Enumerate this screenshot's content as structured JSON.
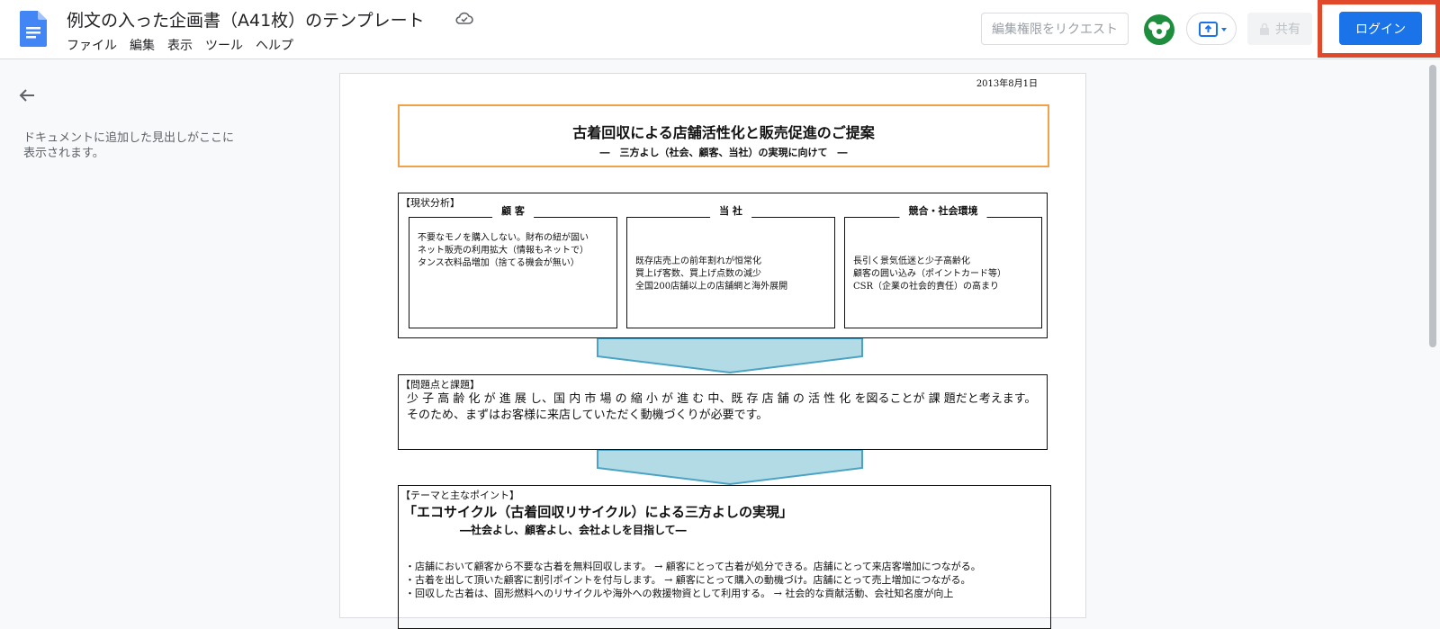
{
  "header": {
    "doc_title": "例文の入った企画書（A41枚）のテンプレート",
    "menu": [
      "ファイル",
      "編集",
      "表示",
      "ツール",
      "ヘルプ"
    ],
    "request_edit_label": "編集権限をリクエスト",
    "share_label": "共有",
    "login_label": "ログイン",
    "accent_color": "#1a73e8",
    "highlight_color": "#e04a2a"
  },
  "sidebar": {
    "outline_hint": "ドキュメントに追加した見出しがここに表示されます。"
  },
  "document": {
    "date": "2013年8月1日",
    "title": "古着回収による店舗活性化と販売促進のご提案",
    "subtitle": "―　三方よし（社会、顧客、当社）の実現に向けて　―",
    "analysis": {
      "label": "【現状分析】",
      "columns": [
        {
          "heading": "顧 客",
          "lines": [
            "不要なモノを購入しない。財布の紐が固い",
            "ネット販売の利用拡大（情報もネットで）",
            "タンス衣料品増加（捨てる機会が無い）"
          ]
        },
        {
          "heading": "当 社",
          "lines": [
            "既存店売上の前年割れが恒常化",
            "買上げ客数、買上げ点数の減少",
            "全国200店舗以上の店舗網と海外展開"
          ]
        },
        {
          "heading": "競合・社会環境",
          "lines": [
            "長引く景気低迷と少子高齢化",
            "顧客の囲い込み（ポイントカード等）",
            "CSR（企業の社会的責任）の高まり"
          ]
        }
      ]
    },
    "problem": {
      "label": "【問題点と課題】",
      "lines": [
        "少 子 高 齢 化 が 進 展 し、国 内 市 場 の 縮 小 が 進 む 中、既 存 店 舗 の 活 性 化 を図ることが 課 題だと考えます。",
        "そのため、まずはお客様に来店していただく動機づくりが必要です。"
      ]
    },
    "theme": {
      "label": "【テーマと主なポイント】",
      "title": "「エコサイクル（古着回収リサイクル）による三方よしの実現」",
      "subtitle": "―社会よし、顧客よし、会社よしを目指して―",
      "bullets": [
        "・店舗において顧客から不要な古着を無料回収します。 →  顧客にとって古着が処分できる。店舗にとって来店客増加につながる。",
        "・古着を出して頂いた顧客に割引ポイントを付与します。 →  顧客にとって購入の動機づけ。店舗にとって売上増加につながる。",
        "・回収した古着は、固形燃料へのリサイクルや海外への救援物資として利用する。 →  社会的な貢献活動、会社知名度が向上"
      ]
    }
  }
}
